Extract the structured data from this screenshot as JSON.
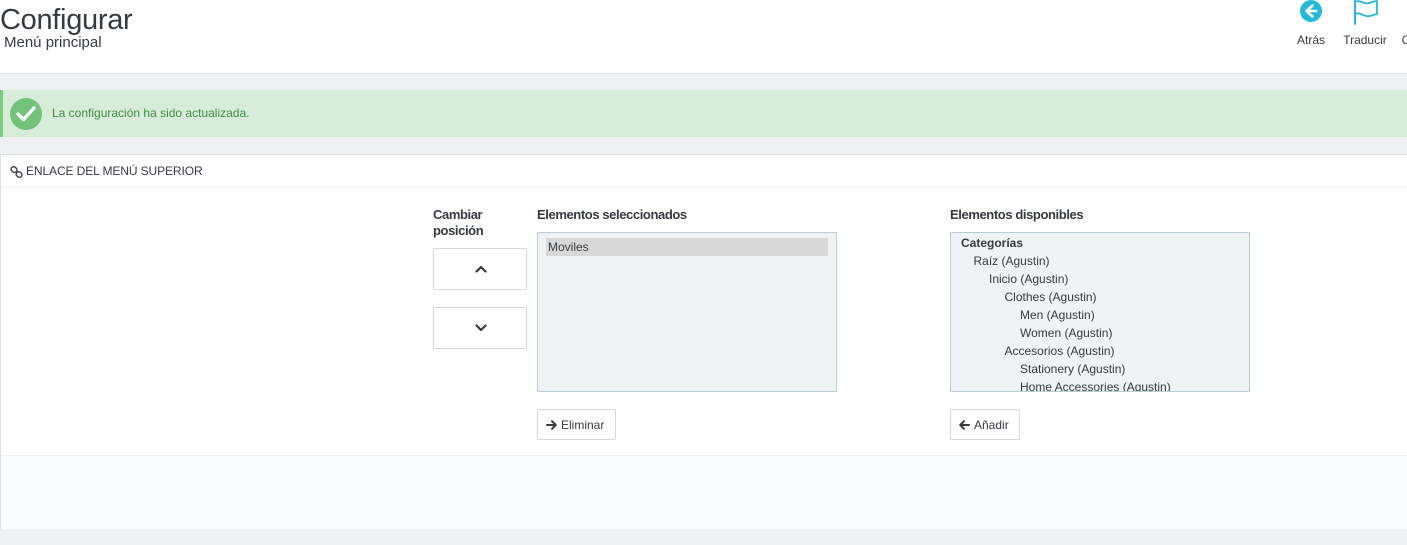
{
  "header": {
    "title": "Configurar",
    "subtitle": "Menú principal"
  },
  "toolbar": {
    "back_label": "Atrás",
    "translate_label": "Traducir",
    "truncated_label": "C"
  },
  "alert": {
    "message": "La configuración ha sido actualizada.",
    "color": "#72c279"
  },
  "panel": {
    "heading": "Enlace del menú superior",
    "change_position_label": "Cambiar posición",
    "selected_label": "Elementos seleccionados",
    "available_label": "Elementos disponibles",
    "selected_items": [
      "Moviles"
    ],
    "available_group": "Categorías",
    "available_items": [
      {
        "label": "Raíz (Agustin)",
        "level": 1
      },
      {
        "label": "Inicio (Agustin)",
        "level": 2
      },
      {
        "label": "Clothes (Agustin)",
        "level": 3
      },
      {
        "label": "Men (Agustin)",
        "level": 4
      },
      {
        "label": "Women (Agustin)",
        "level": 4
      },
      {
        "label": "Accesorios (Agustin)",
        "level": 3
      },
      {
        "label": "Stationery (Agustin)",
        "level": 4
      },
      {
        "label": "Home Accessories (Agustin)",
        "level": 4
      }
    ],
    "remove_label": "Eliminar",
    "add_label": "Añadir"
  },
  "colors": {
    "accent": "#25b9d7",
    "success_bg": "#d7ecd9",
    "success_text": "#3d8e44"
  }
}
